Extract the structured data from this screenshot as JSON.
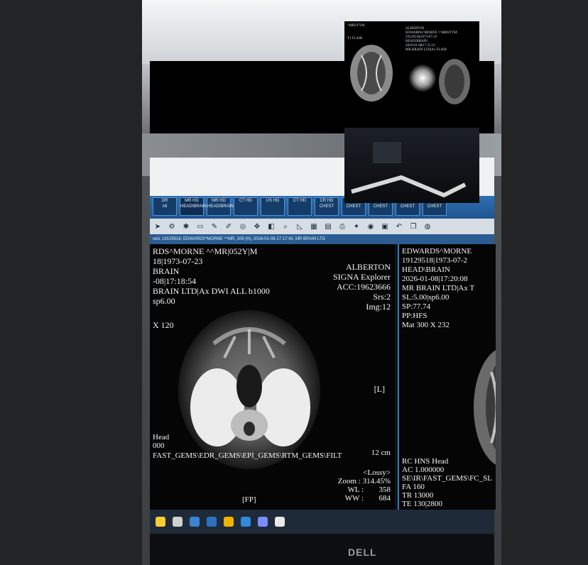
{
  "photo": {
    "brand": "DELL"
  },
  "viewer": {
    "series_tabs": [
      {
        "label": "DR",
        "sub": "All",
        "active": false
      },
      {
        "label": "MR HD",
        "sub": "HEAD\\BRAIN",
        "active": true
      },
      {
        "label": "MR HD",
        "sub": "HEAD\\BRAIN",
        "active": false
      },
      {
        "label": "CT HD",
        "sub": "",
        "active": false
      },
      {
        "label": "US HD",
        "sub": "",
        "active": false
      },
      {
        "label": "CT HD",
        "sub": "",
        "active": false
      },
      {
        "label": "CR HD",
        "sub": "CHEST",
        "active": false
      },
      {
        "label": "CR HD",
        "sub": "CHEST",
        "active": false
      },
      {
        "label": "CR HD",
        "sub": "CHEST",
        "active": false
      },
      {
        "label": "CR",
        "sub": "CHEST",
        "active": false
      },
      {
        "label": "CR",
        "sub": "CHEST",
        "active": false
      }
    ],
    "status_text": "ved, 19129518, EDWARDS^MORNE ^^MR, 109 (H), 2026-01-08 17:17:43, MR BRAIN LTD"
  },
  "left_viewport": {
    "patient_name": "RDS^MORNE ^^MR|052Y|M",
    "patient_id_dob": "18|1973-07-23",
    "study": "BRAIN",
    "date_time": "-08|17:18:54",
    "series": "BRAIN LTD|Ax DWI ALL b1000",
    "slice": "sp6.00",
    "matrix": "X 120",
    "institution": "ALBERTON",
    "scanner": "SIGNA Explorer",
    "accession": "ACC:19623666",
    "srs": "Srs:2",
    "img": "Img:12",
    "orientation_marker": "[L]",
    "scale": "12 cm",
    "coil": "Head",
    "coil_value": "000",
    "sequence": "FAST_GEMS\\EDR_GEMS\\EPI_GEMS\\RTM_GEMS\\FILT",
    "lossy": "<Lossy>",
    "zoom": "Zoom : 314.45%",
    "wl": "WL :",
    "wl_value": "358",
    "ww": "WW :",
    "ww_value": "684",
    "fp": "[FP]"
  },
  "right_viewport": {
    "patient_name": "EDWARDS^MORNE",
    "patient_id_dob": "19129518|1973-07-2",
    "study": "HEAD\\BRAIN",
    "date_time": "2026-01-08|17:20:08",
    "series": "MR BRAIN LTD|Ax T",
    "slice": "SL:5.00|sp6.00",
    "sp": "SP:77.74",
    "pp": "PP:HFS",
    "matrix": "Mat 300 X 232",
    "coil": "RC HNS Head",
    "ac": "AC 1.000000",
    "sequence": "SE\\IR\\FAST_GEMS\\FC_SL",
    "fa": "FA 160",
    "tr": "TR 13000",
    "te": "TE 130|2800"
  },
  "reference_photo": {
    "header_left": "^MRSYYM",
    "header_right_1": "ALBERTON",
    "header_right_2": "EDWARDS^MORNE ^^MRSYYM",
    "header_right_3": "19129518|1973-07-23",
    "header_right_4": "HEAD\\BRAIN",
    "header_right_5": "2026-01-08|17:15:21",
    "header_right_6": "MR BRAIN LTD|Ax FLAIR",
    "left_label": "T1 FLAIR"
  }
}
